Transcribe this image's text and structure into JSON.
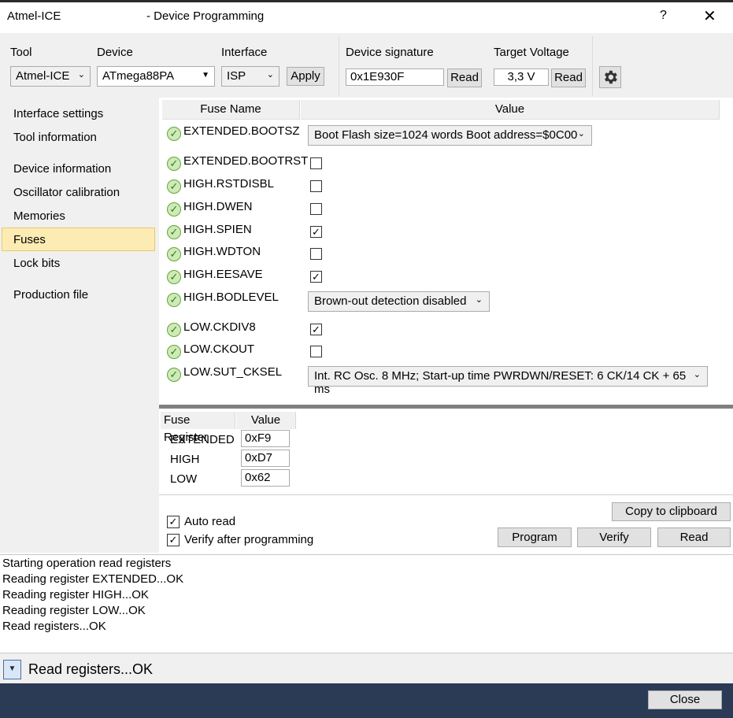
{
  "window": {
    "app_title": "Atmel-ICE",
    "title": "- Device Programming",
    "help_label": "?",
    "close_glyph": "✕"
  },
  "toolbar": {
    "tool_label": "Tool",
    "tool_value": "Atmel-ICE",
    "device_label": "Device",
    "device_value": "ATmega88PA",
    "interface_label": "Interface",
    "interface_value": "ISP",
    "apply_label": "Apply",
    "signature_label": "Device signature",
    "signature_value": "0x1E930F",
    "signature_read_label": "Read",
    "voltage_label": "Target Voltage",
    "voltage_value": "3,3 V",
    "voltage_read_label": "Read",
    "settings_icon": "gear-icon"
  },
  "sidebar": {
    "items": [
      {
        "label": "Interface settings"
      },
      {
        "label": "Tool information"
      },
      {
        "label": "Device information"
      },
      {
        "label": "Oscillator calibration"
      },
      {
        "label": "Memories"
      },
      {
        "label": "Fuses"
      },
      {
        "label": "Lock bits"
      },
      {
        "label": "Production file"
      }
    ],
    "selected": "Fuses"
  },
  "fuses": {
    "col_name": "Fuse Name",
    "col_value": "Value",
    "rows": [
      {
        "name": "EXTENDED.BOOTSZ",
        "type": "select",
        "value": "Boot Flash size=1024 words Boot address=$0C00"
      },
      {
        "name": "EXTENDED.BOOTRST",
        "type": "checkbox",
        "checked": false
      },
      {
        "name": "HIGH.RSTDISBL",
        "type": "checkbox",
        "checked": false
      },
      {
        "name": "HIGH.DWEN",
        "type": "checkbox",
        "checked": false
      },
      {
        "name": "HIGH.SPIEN",
        "type": "checkbox",
        "checked": true
      },
      {
        "name": "HIGH.WDTON",
        "type": "checkbox",
        "checked": false
      },
      {
        "name": "HIGH.EESAVE",
        "type": "checkbox",
        "checked": true
      },
      {
        "name": "HIGH.BODLEVEL",
        "type": "select",
        "value": "Brown-out detection disabled"
      },
      {
        "name": "LOW.CKDIV8",
        "type": "checkbox",
        "checked": true
      },
      {
        "name": "LOW.CKOUT",
        "type": "checkbox",
        "checked": false
      },
      {
        "name": "LOW.SUT_CKSEL",
        "type": "select",
        "value": "Int. RC Osc. 8 MHz; Start-up time PWRDWN/RESET: 6 CK/14 CK + 65 ms"
      }
    ]
  },
  "registers": {
    "col_register": "Fuse Register",
    "col_value": "Value",
    "rows": [
      {
        "name": "EXTENDED",
        "value": "0xF9"
      },
      {
        "name": "HIGH",
        "value": "0xD7"
      },
      {
        "name": "LOW",
        "value": "0x62"
      }
    ]
  },
  "options": {
    "auto_read_label": "Auto read",
    "auto_read": true,
    "verify_label": "Verify after programming",
    "verify": true
  },
  "actions": {
    "copy_label": "Copy to clipboard",
    "program_label": "Program",
    "verify_label": "Verify",
    "read_label": "Read"
  },
  "log": {
    "lines": [
      "Starting operation read registers",
      "Reading register EXTENDED...OK",
      "Reading register HIGH...OK",
      "Reading register LOW...OK",
      "Read registers...OK"
    ]
  },
  "status": {
    "text": "Read registers...OK"
  },
  "footer": {
    "close_label": "Close"
  },
  "colors": {
    "selected_bg": "#fcebb3",
    "footer_bg": "#2b3a55",
    "ok_green": "#5fa935"
  }
}
